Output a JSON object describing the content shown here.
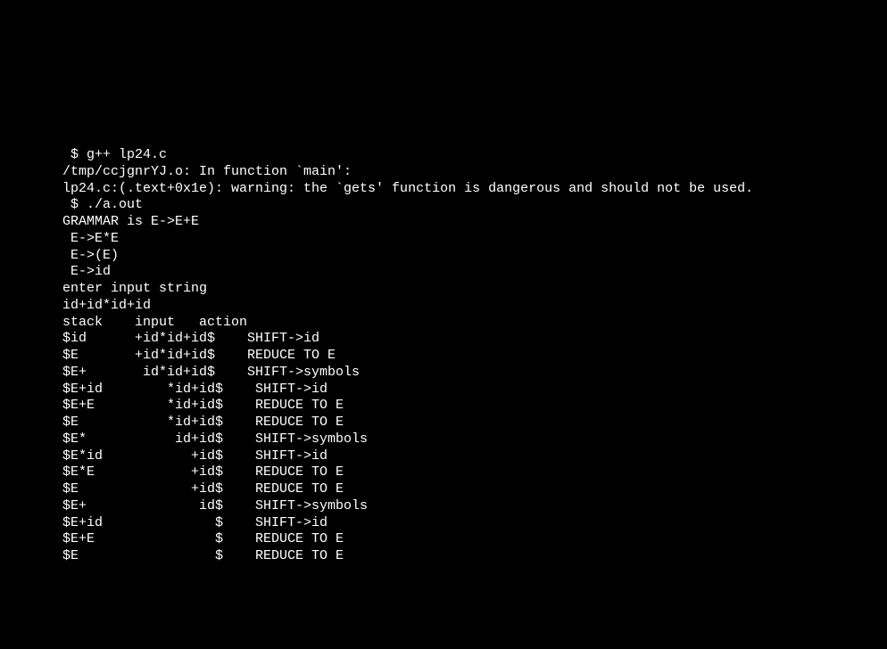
{
  "terminal": {
    "lines": [
      " $ g++ lp24.c",
      "/tmp/ccjgnrYJ.o: In function `main':",
      "lp24.c:(.text+0x1e): warning: the `gets' function is dangerous and should not be used.",
      " $ ./a.out",
      "GRAMMAR is E->E+E",
      " E->E*E",
      " E->(E)",
      " E->id",
      "enter input string",
      "id+id*id+id",
      "stack    input   action",
      "",
      "$id      +id*id+id$    SHIFT->id",
      "$E       +id*id+id$    REDUCE TO E",
      "$E+       id*id+id$    SHIFT->symbols",
      "$E+id        *id+id$    SHIFT->id",
      "$E+E         *id+id$    REDUCE TO E",
      "$E           *id+id$    REDUCE TO E",
      "$E*           id+id$    SHIFT->symbols",
      "$E*id           +id$    SHIFT->id",
      "$E*E            +id$    REDUCE TO E",
      "$E              +id$    REDUCE TO E",
      "$E+              id$    SHIFT->symbols",
      "$E+id              $    SHIFT->id",
      "$E+E               $    REDUCE TO E",
      "$E                 $    REDUCE TO E"
    ]
  }
}
